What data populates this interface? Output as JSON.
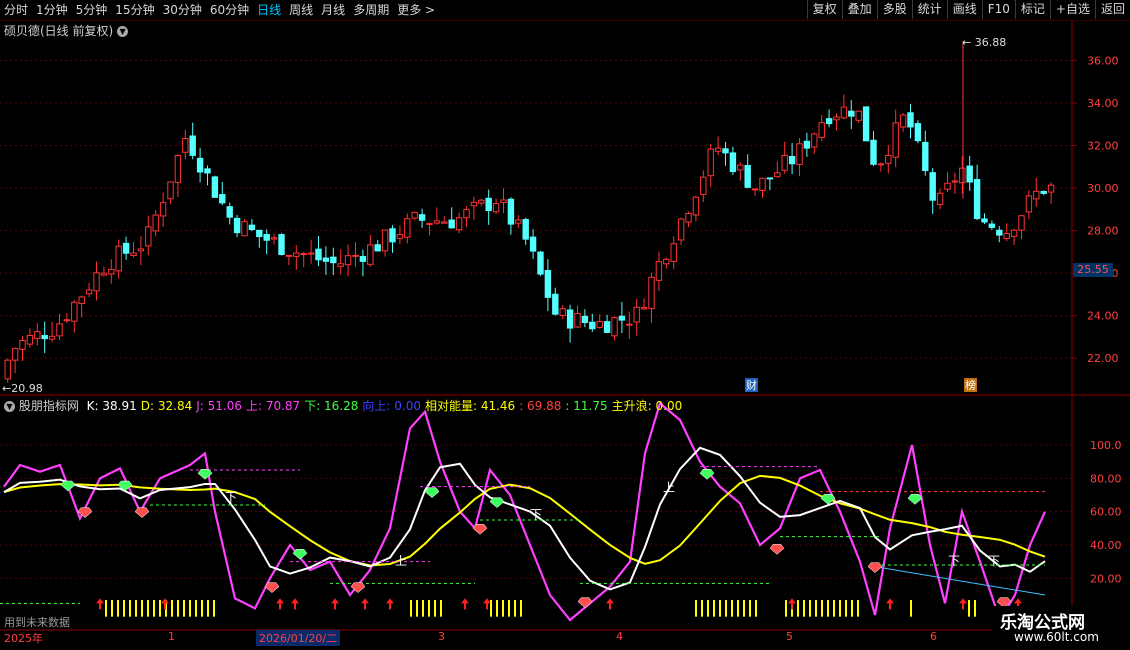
{
  "toolbar": {
    "periods": [
      "分时",
      "1分钟",
      "5分钟",
      "15分钟",
      "30分钟",
      "60分钟",
      "日线",
      "周线",
      "月线",
      "多周期",
      "更多 >"
    ],
    "active_period": "日线",
    "right_buttons": [
      "复权",
      "叠加",
      "多股",
      "统计",
      "画线",
      "F10",
      "标记",
      "+自选",
      "返回"
    ]
  },
  "main_panel": {
    "title": "硕贝德(日线 前复权)",
    "high_label": "36.88",
    "low_label": "20.98",
    "current_price": "25.55",
    "markers": [
      "财",
      "榜"
    ],
    "price_ticks": [
      "36.00",
      "34.00",
      "32.00",
      "30.00",
      "28.00",
      "26.00",
      "24.00",
      "22.00"
    ],
    "price_range": [
      20.5,
      37.2
    ]
  },
  "indicator_panel": {
    "name": "股朋指标网",
    "values": [
      {
        "label": "K:",
        "value": "38.91",
        "color": "#ffffff"
      },
      {
        "label": "D:",
        "value": "32.84",
        "color": "#ffff00"
      },
      {
        "label": "J:",
        "value": "51.06",
        "color": "#ff40ff"
      },
      {
        "label": "上:",
        "value": "70.87",
        "color": "#ff40ff"
      },
      {
        "label": "下:",
        "value": "16.28",
        "color": "#40ff40"
      },
      {
        "label": "向上:",
        "value": "0.00",
        "color": "#4040ff"
      },
      {
        "label": "相对能量:",
        "value": "41.46",
        "color": "#ffff00"
      },
      {
        "label": ":",
        "value": "69.88",
        "color": "#ff4040"
      },
      {
        "label": ":",
        "value": "11.75",
        "color": "#40ff40"
      },
      {
        "label": "主升浪:",
        "value": "0.00",
        "color": "#ffff00"
      }
    ],
    "ticks": [
      "100.0",
      "80.00",
      "60.00",
      "40.00",
      "20.00"
    ],
    "range": [
      -8,
      115
    ],
    "future_text": "用到未来数据",
    "labels_up": "上",
    "labels_down": "下"
  },
  "time_axis": {
    "labels": [
      "2025年",
      "1",
      "2026/01/20/二",
      "3",
      "4",
      "5",
      "6"
    ]
  },
  "watermark": {
    "name": "乐淘公式网",
    "url": "www.60lt.com"
  },
  "colors": {
    "up": "#ff3232",
    "down": "#54ffff",
    "k": "#ffffff",
    "d": "#ffff00",
    "j": "#ff40ff"
  }
}
